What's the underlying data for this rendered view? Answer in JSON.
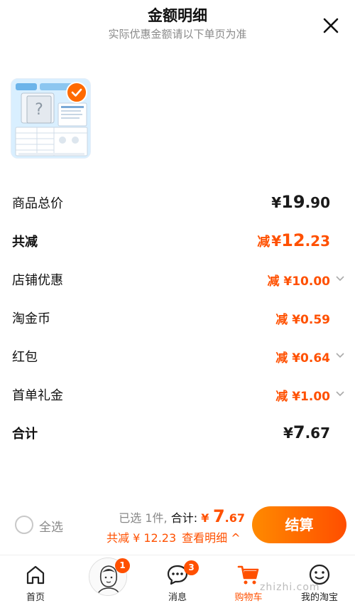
{
  "header": {
    "title": "金额明细",
    "subtitle": "实际优惠金额请以下单页为准"
  },
  "rows": {
    "total_price": {
      "label": "商品总价",
      "currency": "¥",
      "integer": "19",
      "decimal": ".90"
    },
    "total_discount": {
      "label": "共减",
      "prefix": "减",
      "currency": "¥",
      "integer": "12",
      "decimal": ".23"
    },
    "shop_discount": {
      "label": "店铺优惠",
      "value": "减 ¥10.00"
    },
    "taojinbi": {
      "label": "淘金币",
      "value": "减 ¥0.59"
    },
    "hongbao": {
      "label": "红包",
      "value": "减 ¥0.64"
    },
    "first_order": {
      "label": "首单礼金",
      "value": "减 ¥1.00"
    },
    "sum": {
      "label": "合计",
      "currency": "¥",
      "integer": "7",
      "decimal": ".67"
    }
  },
  "actionbar": {
    "select_all": "全选",
    "selected_count": "已选 1件,",
    "total_label": "合计:",
    "total_currency": "¥",
    "total_integer": "7",
    "total_decimal": ".67",
    "discount_text": "共减 ¥ 12.23",
    "view_detail": "查看明细 ^",
    "checkout": "结算"
  },
  "tabbar": {
    "tabs": [
      {
        "label": "首页",
        "icon": "home-icon"
      },
      {
        "label": "",
        "icon": "avatar-icon",
        "badge": "1"
      },
      {
        "label": "消息",
        "icon": "message-icon",
        "badge": "3"
      },
      {
        "label": "购物车",
        "icon": "cart-icon",
        "active": true
      },
      {
        "label": "我的淘宝",
        "icon": "profile-icon"
      }
    ]
  },
  "watermark": "zhizhi.com",
  "colors": {
    "accent": "#ff5000",
    "checkout_start": "#ff8a00",
    "checkout_end": "#ff4e00"
  }
}
